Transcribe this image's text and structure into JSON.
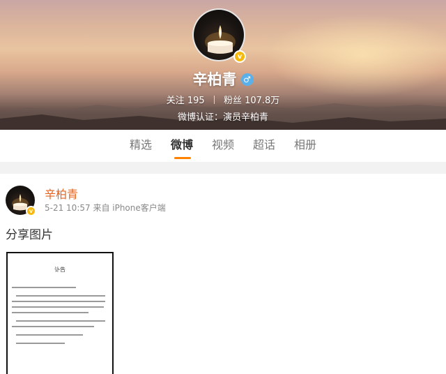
{
  "profile": {
    "name": "辛柏青",
    "gender_symbol": "♂",
    "verified_badge": "v",
    "follow_label": "关注",
    "follow_count": "195",
    "fans_label": "粉丝",
    "fans_count": "107.8万",
    "verification": "微博认证：演员辛柏青"
  },
  "tabs": [
    {
      "label": "精选",
      "active": false
    },
    {
      "label": "微博",
      "active": true
    },
    {
      "label": "视频",
      "active": false
    },
    {
      "label": "超话",
      "active": false
    },
    {
      "label": "相册",
      "active": false
    }
  ],
  "post": {
    "author": "辛柏青",
    "meta": "5-21 10:57  来自 iPhone客户端",
    "text": "分享图片",
    "image": {
      "title": "讣告"
    }
  },
  "colors": {
    "accent": "#ff8200",
    "author_name": "#e8621b",
    "verified_badge": "#f5b90f",
    "gender_badge": "#5ab0e9"
  }
}
